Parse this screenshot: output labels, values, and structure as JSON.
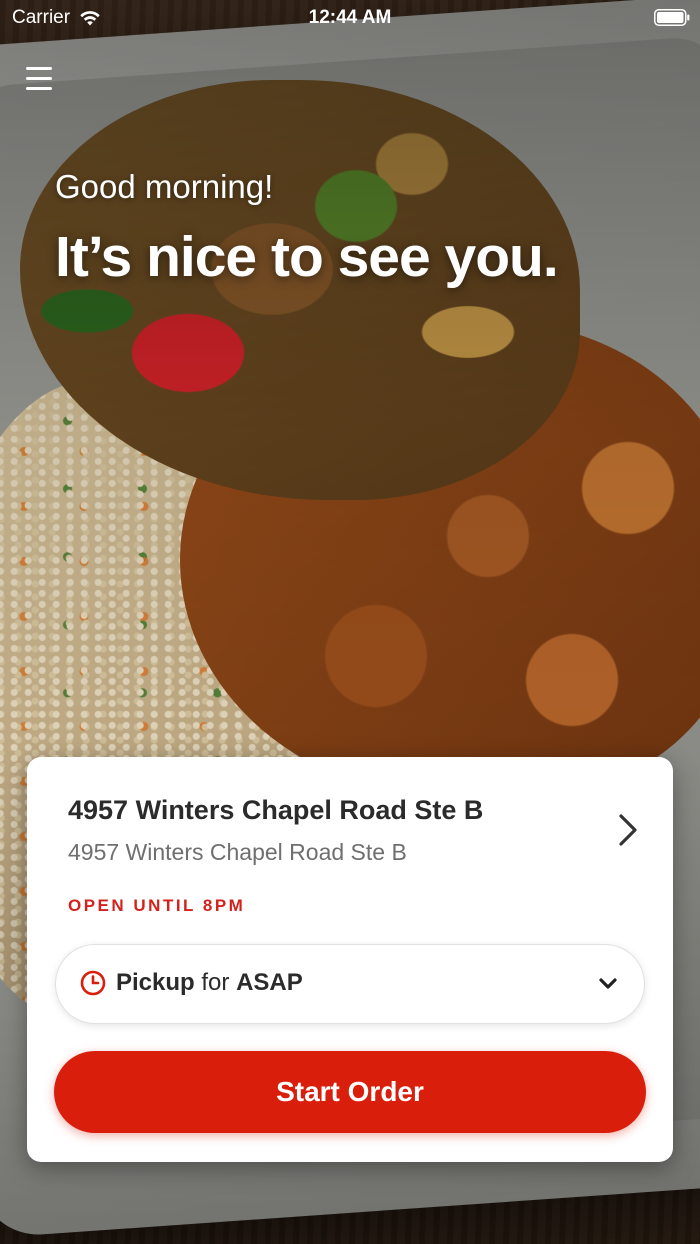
{
  "status_bar": {
    "carrier": "Carrier",
    "time": "12:44 AM",
    "icons": [
      "wifi-icon",
      "battery-icon"
    ]
  },
  "header": {
    "menu_icon": "hamburger-menu-icon"
  },
  "hero": {
    "greeting": "Good morning!",
    "headline": "It’s nice to see you."
  },
  "location_card": {
    "name": "4957 Winters Chapel Road Ste B",
    "address": "4957 Winters Chapel Road Ste B",
    "hours": "OPEN UNTIL 8PM",
    "chevron_icon": "chevron-right-icon"
  },
  "order_mode": {
    "icon": "clock-icon",
    "mode": "Pickup",
    "connector": "for",
    "time": "ASAP",
    "caret_icon": "chevron-down-icon"
  },
  "start_order": {
    "label": "Start Order"
  },
  "colors": {
    "accent": "#d91f0c",
    "hours_text": "#d3221b",
    "card_bg": "#ffffff"
  }
}
